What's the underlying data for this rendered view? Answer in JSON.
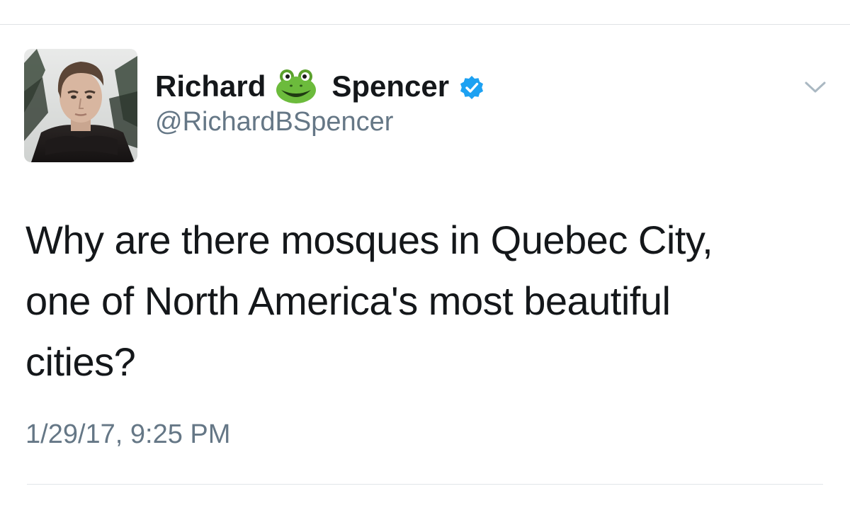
{
  "user": {
    "name_first": "Richard",
    "name_emoji_icon": "frog-face-icon",
    "name_last": "Spencer",
    "verified_icon": "verified-badge-icon",
    "handle": "@RichardBSpencer"
  },
  "tweet": {
    "lines": [
      "Why are there mosques in Quebec City,",
      "one of North America's most beautiful",
      "cities?"
    ],
    "timestamp": "1/29/17, 9:25 PM"
  },
  "menu": {
    "icon": "chevron-down-icon"
  },
  "colors": {
    "text_primary": "#14171a",
    "text_secondary": "#657786",
    "verified_blue": "#1da1f2",
    "chevron_gray": "#aab8c2",
    "divider": "#e1e5e8"
  }
}
